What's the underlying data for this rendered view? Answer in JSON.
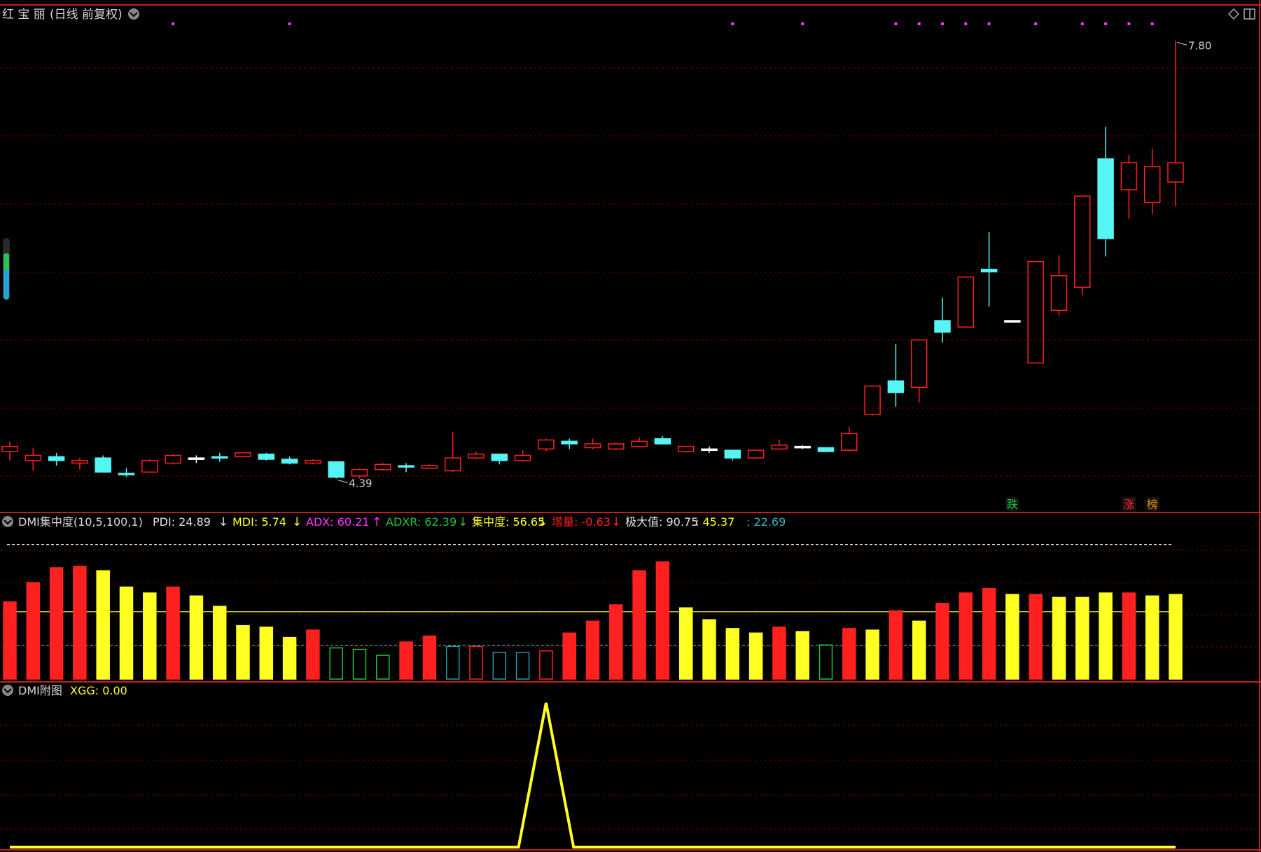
{
  "title": {
    "name": "红 宝 丽",
    "mode": "(日线 前复权)"
  },
  "colors": {
    "up": "#ff2020",
    "down": "#55f5f5",
    "flat": "#ffffff",
    "yellow": "#ffff22",
    "green": "#22c33c",
    "cyan_outline": "#1f9aa8",
    "magenta": "#ff33ff",
    "grid": "#7a0000",
    "frame": "#c81c1c"
  },
  "chart_data": [
    {
      "type": "candlestick",
      "title": "红 宝 丽(日线 前复权)",
      "ylim": [
        4.3,
        7.9
      ],
      "price_marks": [
        {
          "text": "4.39",
          "candle": 14,
          "value": 4.39
        },
        {
          "text": "7.80",
          "candle": 50,
          "value": 7.8
        }
      ],
      "top_dot_candles": [
        7,
        12,
        31,
        34,
        38,
        39,
        40,
        41,
        42,
        44,
        46,
        47,
        48,
        49
      ],
      "ohlc": [
        [
          4.6,
          4.64,
          4.53,
          4.68
        ],
        [
          4.53,
          4.57,
          4.45,
          4.63
        ],
        [
          4.56,
          4.53,
          4.49,
          4.59
        ],
        [
          4.51,
          4.53,
          4.46,
          4.55
        ],
        [
          4.55,
          4.44,
          4.44,
          4.57
        ],
        [
          4.43,
          4.43,
          4.4,
          4.47
        ],
        [
          4.44,
          4.53,
          4.44,
          4.54
        ],
        [
          4.51,
          4.57,
          4.5,
          4.58
        ],
        [
          4.55,
          4.55,
          4.51,
          4.57
        ],
        [
          4.56,
          4.56,
          4.52,
          4.59
        ],
        [
          4.56,
          4.59,
          4.56,
          4.59
        ],
        [
          4.58,
          4.54,
          4.53,
          4.59
        ],
        [
          4.54,
          4.51,
          4.5,
          4.56
        ],
        [
          4.51,
          4.53,
          4.5,
          4.54
        ],
        [
          4.52,
          4.4,
          4.39,
          4.52
        ],
        [
          4.41,
          4.46,
          4.39,
          4.47
        ],
        [
          4.46,
          4.5,
          4.45,
          4.51
        ],
        [
          4.49,
          4.48,
          4.44,
          4.51
        ],
        [
          4.47,
          4.49,
          4.47,
          4.5
        ],
        [
          4.45,
          4.55,
          4.44,
          4.75
        ],
        [
          4.55,
          4.58,
          4.54,
          4.6
        ],
        [
          4.58,
          4.53,
          4.5,
          4.58
        ],
        [
          4.53,
          4.57,
          4.52,
          4.61
        ],
        [
          4.62,
          4.69,
          4.6,
          4.7
        ],
        [
          4.68,
          4.66,
          4.62,
          4.7
        ],
        [
          4.63,
          4.66,
          4.62,
          4.7
        ],
        [
          4.62,
          4.66,
          4.61,
          4.67
        ],
        [
          4.64,
          4.68,
          4.64,
          4.71
        ],
        [
          4.7,
          4.66,
          4.66,
          4.72
        ],
        [
          4.6,
          4.64,
          4.59,
          4.64
        ],
        [
          4.62,
          4.62,
          4.59,
          4.64
        ],
        [
          4.61,
          4.55,
          4.53,
          4.61
        ],
        [
          4.55,
          4.61,
          4.54,
          4.61
        ],
        [
          4.62,
          4.65,
          4.62,
          4.69
        ],
        [
          4.64,
          4.64,
          4.62,
          4.65
        ],
        [
          4.63,
          4.6,
          4.6,
          4.63
        ],
        [
          4.61,
          4.74,
          4.6,
          4.79
        ],
        [
          4.89,
          5.11,
          4.88,
          5.11
        ],
        [
          5.15,
          5.06,
          4.95,
          5.44
        ],
        [
          5.1,
          5.47,
          4.98,
          5.47
        ],
        [
          5.62,
          5.53,
          5.45,
          5.8
        ],
        [
          5.57,
          5.96,
          5.57,
          5.96
        ],
        [
          6.02,
          6.0,
          5.73,
          6.31
        ],
        [
          5.62,
          5.62,
          5.62,
          5.62
        ],
        [
          5.29,
          6.08,
          5.29,
          6.08
        ],
        [
          5.7,
          5.97,
          5.66,
          6.13
        ],
        [
          5.88,
          6.59,
          5.82,
          6.59
        ],
        [
          6.88,
          6.26,
          6.12,
          7.13
        ],
        [
          6.64,
          6.85,
          6.41,
          6.91
        ],
        [
          6.54,
          6.82,
          6.45,
          6.96
        ],
        [
          6.7,
          6.85,
          6.51,
          7.8
        ]
      ],
      "markers": [
        {
          "text": "跌",
          "candle": 43,
          "color": "#22c33c"
        },
        {
          "text": "涨",
          "candle": 48,
          "color": "#ff2020"
        },
        {
          "text": "榜",
          "candle": 49,
          "color": "#e88a1a"
        }
      ]
    },
    {
      "type": "bar",
      "title": "DMI集中度(10,5,100,1)",
      "ylim": [
        0,
        100
      ],
      "legend": [
        {
          "text": "PDI: 24.89",
          "arrow": "↓",
          "color": "#e6e6e6"
        },
        {
          "text": "MDI: 5.74",
          "arrow": "↓",
          "color": "#ffff22"
        },
        {
          "text": "ADX: 60.21",
          "arrow": "↑",
          "color": "#ff33ff"
        },
        {
          "text": "ADXR: 62.39",
          "arrow": "↓",
          "color": "#22c33c"
        },
        {
          "text": "集中度: 56.65",
          "arrow": "↓",
          "color": "#ffff22"
        },
        {
          "text": "增量: -0.63",
          "arrow": "↓",
          "color": "#ff2020"
        },
        {
          "text": "极大值: 90.75",
          "arrow": "",
          "color": "#e6e6e6"
        },
        {
          "text": ": 45.37",
          "arrow": "",
          "color": "#ffff22"
        },
        {
          "text": ": 22.69",
          "arrow": "",
          "color": "#3ab3c0"
        }
      ],
      "hlines": [
        {
          "value": 90.75,
          "color": "#ffffff",
          "style": "dashed"
        },
        {
          "value": 45.37,
          "color": "#ffff22",
          "style": "solid"
        },
        {
          "value": 22.69,
          "color": "#3ab3c0",
          "style": "dashed"
        }
      ],
      "values": [
        52,
        65,
        75,
        76,
        73,
        62,
        58,
        62,
        56,
        49,
        36,
        35,
        28,
        33,
        21,
        20,
        16,
        25,
        29,
        22,
        22,
        18,
        18,
        19,
        31,
        39,
        50,
        73,
        79,
        48,
        40,
        34,
        31,
        35,
        32,
        23,
        34,
        33,
        46,
        39,
        51,
        58,
        61,
        57,
        57,
        55,
        55,
        58,
        58,
        56,
        57
      ],
      "styles": [
        "R",
        "R",
        "R",
        "R",
        "Y",
        "Y",
        "Y",
        "R",
        "Y",
        "Y",
        "Y",
        "Y",
        "Y",
        "R",
        "G",
        "G",
        "G",
        "R",
        "R",
        "C",
        "RO",
        "C",
        "C",
        "RO",
        "R",
        "R",
        "R",
        "R",
        "R",
        "Y",
        "Y",
        "Y",
        "Y",
        "R",
        "Y",
        "G",
        "R",
        "Y",
        "R",
        "Y",
        "R",
        "R",
        "R",
        "Y",
        "R",
        "Y",
        "Y",
        "Y",
        "R",
        "Y",
        "Y"
      ]
    },
    {
      "type": "line",
      "title": "DMI附图",
      "legend": [
        {
          "text": "XGG: 0.00",
          "color": "#ffff22"
        }
      ],
      "ylim": [
        0,
        1
      ],
      "spike": {
        "start": 22,
        "peak": 23,
        "end": 24
      },
      "count": 51
    }
  ]
}
